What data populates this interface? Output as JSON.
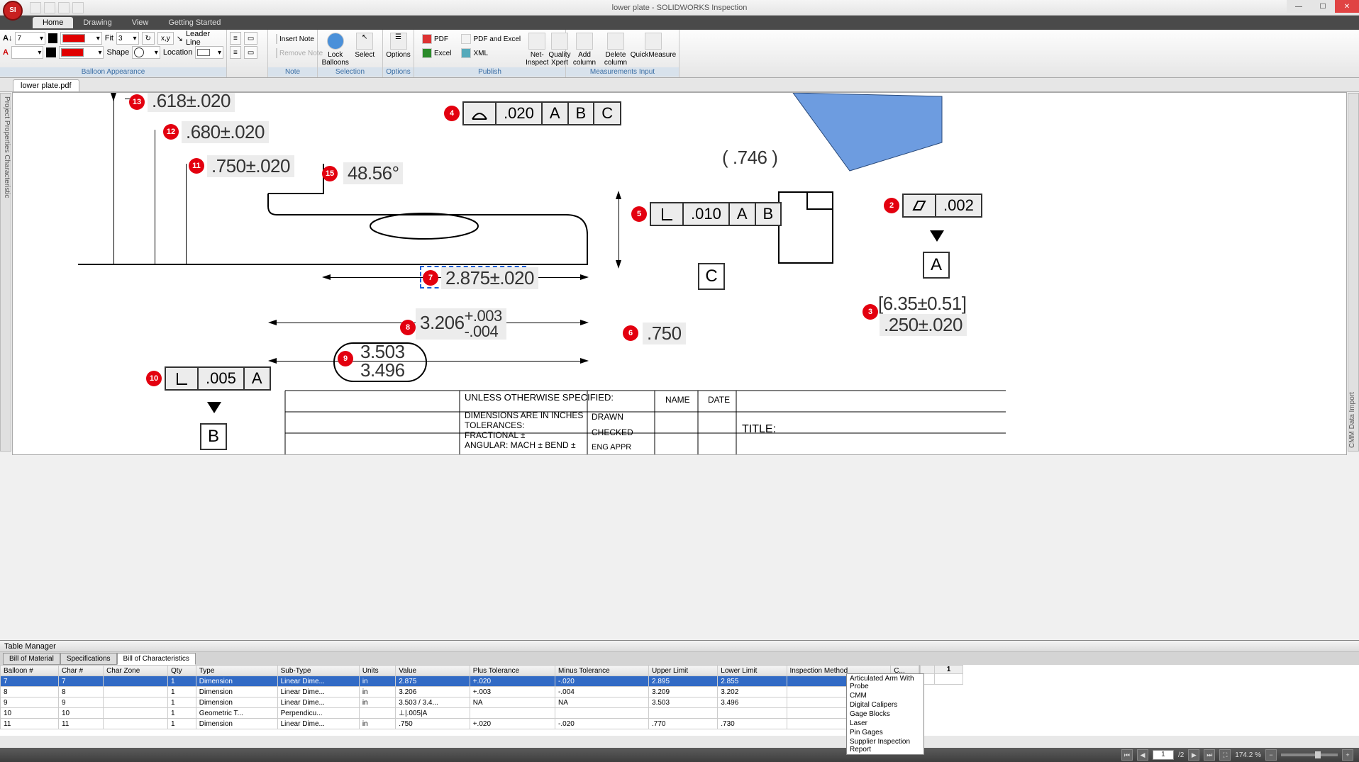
{
  "app": {
    "title": "lower plate - SOLIDWORKS Inspection"
  },
  "menu": {
    "tabs": [
      "Home",
      "Drawing",
      "View",
      "Getting Started"
    ],
    "active": 0
  },
  "ribbon": {
    "fontsize_input": "7",
    "fit_label": "Fit",
    "fit_value": "3",
    "shape_label": "Shape",
    "location_label": "Location",
    "leader_line": "Leader Line",
    "groups": {
      "balloon": "Balloon Appearance",
      "note": "Note",
      "selection": "Selection",
      "options": "Options",
      "publish": "Publish",
      "measure": "Measurements Input"
    },
    "insert_note": "Insert Note",
    "remove_note": "Remove Note",
    "lock_balloons": "Lock Balloons",
    "select": "Select",
    "options_btn": "Options",
    "pdf": "PDF",
    "pdf_excel": "PDF and Excel",
    "excel": "Excel",
    "xml": "XML",
    "net_inspect": "Net-Inspect",
    "quality_xpert": "Quality Xpert",
    "add_column": "Add column",
    "delete_column": "Delete column",
    "quick_measure": "QuickMeasure"
  },
  "doc_tab": "lower plate.pdf",
  "side_left": "Project Properties   Characteristic",
  "side_right": "CMM Data Import",
  "balloons": {
    "2": "2",
    "3": "3",
    "4": "4",
    "5": "5",
    "6": "6",
    "7": "7",
    "8": "8",
    "9": "9",
    "10": "10",
    "11": "11",
    "12": "12",
    "13": "13",
    "15": "15"
  },
  "dims": {
    "d13": ".618±.020",
    "d12": ".680±.020",
    "d11": ".750±.020",
    "d15": "48.56°",
    "d4_tol": ".020",
    "d4_a": "A",
    "d4_b": "B",
    "d4_c": "C",
    "d5_tol": ".010",
    "d5_a": "A",
    "d5_b": "B",
    "d2_tol": ".002",
    "d3_top": "[6.35±0.51]",
    "d3_bot": ".250±.020",
    "d6": ".750",
    "d7": "2.875±.020",
    "d8_nom": "3.206",
    "d8_pt": "+.003",
    "d8_nt": "-.004",
    "d9_hi": "3.503",
    "d9_lo": "3.496",
    "d10_tol": ".005",
    "d10_a": "A",
    "dref": "( .746 )",
    "datumA": "A",
    "datumB": "B",
    "datumC": "C",
    "tb_unless": "UNLESS OTHERWISE SPECIFIED:",
    "tb_dims": "DIMENSIONS ARE IN INCHES",
    "tb_tol": "TOLERANCES:",
    "tb_frac": "FRACTIONAL ±",
    "tb_ang": "ANGULAR: MACH ±      BEND ±",
    "tb_name": "NAME",
    "tb_date": "DATE",
    "tb_drawn": "DRAWN",
    "tb_checked": "CHECKED",
    "tb_eng": "ENG APPR",
    "tb_title": "TITLE:"
  },
  "table_manager": {
    "title": "Table Manager",
    "tabs": [
      "Bill of Material",
      "Specifications",
      "Bill of Characteristics"
    ],
    "active_tab": 2,
    "columns": [
      "Balloon #",
      "Char #",
      "Char Zone",
      "Qty",
      "Type",
      "Sub-Type",
      "Units",
      "Value",
      "Plus Tolerance",
      "Minus Tolerance",
      "Upper Limit",
      "Lower Limit",
      "Inspection Method",
      "C..."
    ],
    "rows": [
      {
        "b": "7",
        "c": "7",
        "z": "",
        "q": "1",
        "t": "Dimension",
        "st": "Linear Dime...",
        "u": "in",
        "v": "2.875",
        "pt": "+.020",
        "mt": "-.020",
        "ul": "2.895",
        "ll": "2.855",
        "im": "",
        "sel": true
      },
      {
        "b": "8",
        "c": "8",
        "z": "",
        "q": "1",
        "t": "Dimension",
        "st": "Linear Dime...",
        "u": "in",
        "v": "3.206",
        "pt": "+.003",
        "mt": "-.004",
        "ul": "3.209",
        "ll": "3.202",
        "im": ""
      },
      {
        "b": "9",
        "c": "9",
        "z": "",
        "q": "1",
        "t": "Dimension",
        "st": "Linear Dime...",
        "u": "in",
        "v": "3.503 / 3.4...",
        "pt": "NA",
        "mt": "NA",
        "ul": "3.503",
        "ll": "3.496",
        "im": ""
      },
      {
        "b": "10",
        "c": "10",
        "z": "",
        "q": "1",
        "t": "Geometric T...",
        "st": "Perpendicu...",
        "u": "",
        "v": "⊥|.005|A",
        "pt": "",
        "mt": "",
        "ul": "",
        "ll": "",
        "im": ""
      },
      {
        "b": "11",
        "c": "11",
        "z": "",
        "q": "1",
        "t": "Dimension",
        "st": "Linear Dime...",
        "u": "in",
        "v": ".750",
        "pt": "+.020",
        "mt": "-.020",
        "ul": ".770",
        "ll": ".730",
        "im": ""
      }
    ],
    "right_header": "1",
    "dropdown": [
      "Articulated Arm With Probe",
      "CMM",
      "Digital Calipers",
      "Gage Blocks",
      "Laser",
      "Pin Gages",
      "Supplier Inspection Report"
    ]
  },
  "status": {
    "page_cur": "1",
    "page_tot": "/2",
    "zoom": "174.2 %"
  }
}
